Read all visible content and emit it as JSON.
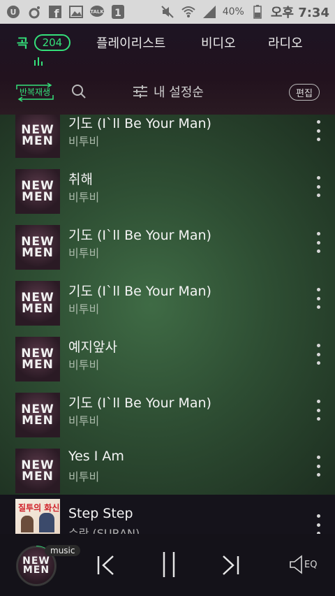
{
  "status_bar": {
    "battery": "40%",
    "time": "오후 7:34",
    "notification_icons": [
      "uplus-icon",
      "kakao-story-icon",
      "facebook-icon",
      "gallery-icon",
      "kakaotalk-icon",
      "badge-one-icon"
    ],
    "system_icons": [
      "mute-icon",
      "wifi-icon",
      "signal-icon",
      "battery-icon"
    ]
  },
  "tabs": {
    "songs": "곡",
    "songs_count": "204",
    "playlist": "플레이리스트",
    "video": "비디오",
    "radio": "라디오"
  },
  "toolbar": {
    "repeat": "반복재생",
    "sort": "내 설정순",
    "edit": "편집"
  },
  "album_art_text": [
    "NEW",
    "MEN"
  ],
  "songs": [
    {
      "title": "기도 (I`ll Be Your Man)",
      "artist": "비투비"
    },
    {
      "title": "취해",
      "artist": "비투비"
    },
    {
      "title": "기도 (I`ll Be Your Man)",
      "artist": "비투비"
    },
    {
      "title": "기도 (I`ll Be Your Man)",
      "artist": "비투비"
    },
    {
      "title": "예지앞사",
      "artist": "비투비"
    },
    {
      "title": "기도 (I`ll Be Your Man)",
      "artist": "비투비"
    },
    {
      "title": "Yes I Am",
      "artist": "비투비"
    }
  ],
  "now_row": {
    "title": "Step Step",
    "artist": "수란 (SURAN)",
    "art_title": "질투의 화신"
  },
  "player": {
    "badge": "music",
    "eq": "EQ"
  },
  "colors": {
    "accent": "#34e07a"
  }
}
